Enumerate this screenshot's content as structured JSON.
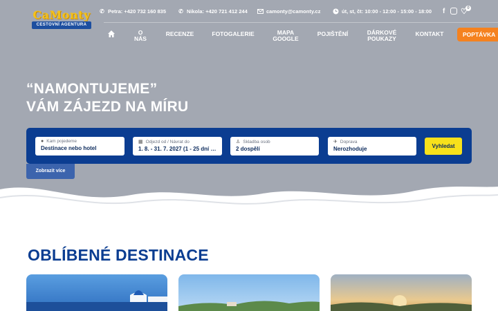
{
  "brand": {
    "logo_text": "CaMonty",
    "logo_subtitle": "CESTOVNÍ AGENTURA"
  },
  "contact": {
    "phone1": "Petra: +420 732 160 835",
    "phone2": "Nikola: +420 721 412 244",
    "email": "camonty@camonty.cz",
    "hours": "út, st, čt: 10:00 - 12:00 - 15:00 - 18:00"
  },
  "social": {
    "wishlist_count": "0"
  },
  "nav": {
    "about_line1": "O",
    "about_line2": "NÁS",
    "reviews": "RECENZE",
    "gallery": "FOTOGALERIE",
    "map_line1": "MAPA",
    "map_line2": "GOOGLE",
    "insurance": "POJIŠTĚNÍ",
    "vouchers_line1": "DÁRKOVÉ",
    "vouchers_line2": "POUKAZY",
    "contact": "KONTAKT",
    "cta": "POPTÁVKA"
  },
  "hero": {
    "line1": "“NAMONTUJEME”",
    "line2": "VÁM ZÁJEZD NA MÍRU"
  },
  "search": {
    "place_label": "Kam pojedeme",
    "place_value": "Destinace nebo hotel",
    "date_label": "Odjezd od / Návrat do",
    "date_value": "1. 8. - 31. 7. 2027 (1 - 25 dní a ví...",
    "people_label": "Skladba osob",
    "people_value": "2 dospělí",
    "transport_label": "Doprava",
    "transport_value": "Nerozhoduje",
    "submit": "Vyhledat",
    "more": "Zobrazit více"
  },
  "destinations": {
    "title": "OBLÍBENÉ DESTINACE"
  },
  "colors": {
    "hero_bg": "#a3a8b2",
    "brand_blue": "#0b3d91",
    "cta_orange": "#f5821f",
    "search_yellow": "#f7e11b"
  }
}
